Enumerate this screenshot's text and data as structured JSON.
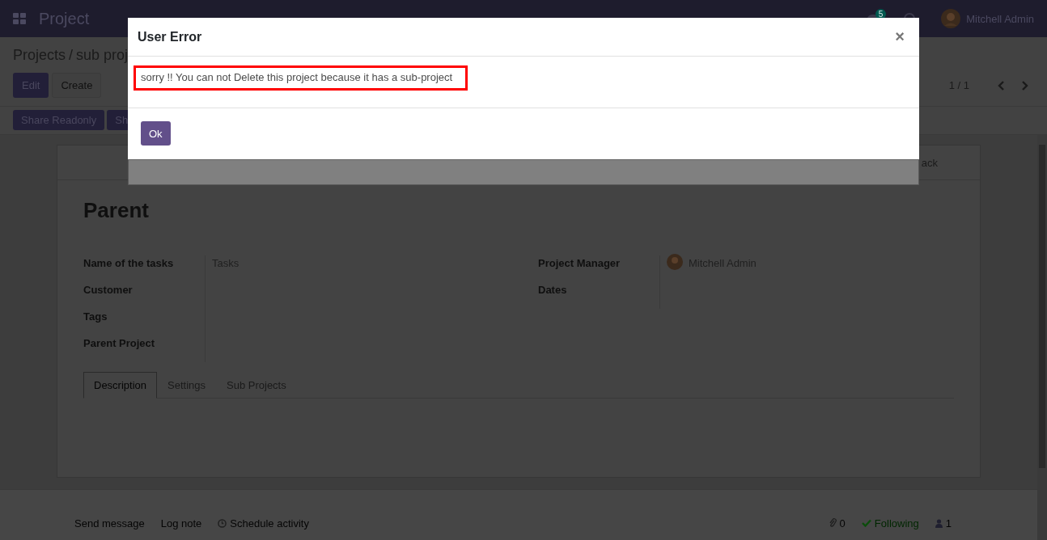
{
  "navbar": {
    "app_name": "Project",
    "message_count": "5",
    "user": "Mitchell Admin"
  },
  "breadcrumb": {
    "items": [
      "Projects",
      "sub proj"
    ],
    "separator": "/"
  },
  "buttons": [
    "Edit",
    "Create"
  ],
  "pager": "1 / 1",
  "action_buttons": [
    "Share Readonly",
    "Sh"
  ],
  "form": {
    "header_text": "ack",
    "title": "Parent",
    "left_fields": [
      {
        "label": "Name of the tasks",
        "value": "Tasks",
        "avatar": false
      },
      {
        "label": "Customer",
        "avatar": false
      },
      {
        "label": "Tags",
        "avatar": false
      },
      {
        "label": "Parent Project",
        "avatar": false
      }
    ],
    "right_fields": [
      {
        "label": "Project Manager",
        "value": "Mitchell Admin",
        "avatar": true
      },
      {
        "label": "Dates",
        "avatar": false
      }
    ],
    "tabs": [
      {
        "label": "Description",
        "selected": true
      },
      {
        "label": "Settings",
        "selected": false
      },
      {
        "label": "Sub Projects",
        "selected": false
      }
    ]
  },
  "chatter": {
    "actions": [
      "Send message",
      "Log note",
      "Schedule activity"
    ],
    "attachments": "0",
    "follow": "Following",
    "followers": "1"
  },
  "dialog": {
    "title": "User Error",
    "close": "×",
    "message": "sorry !! You can not Delete this project because it has a sub-project",
    "button": "Ok"
  }
}
